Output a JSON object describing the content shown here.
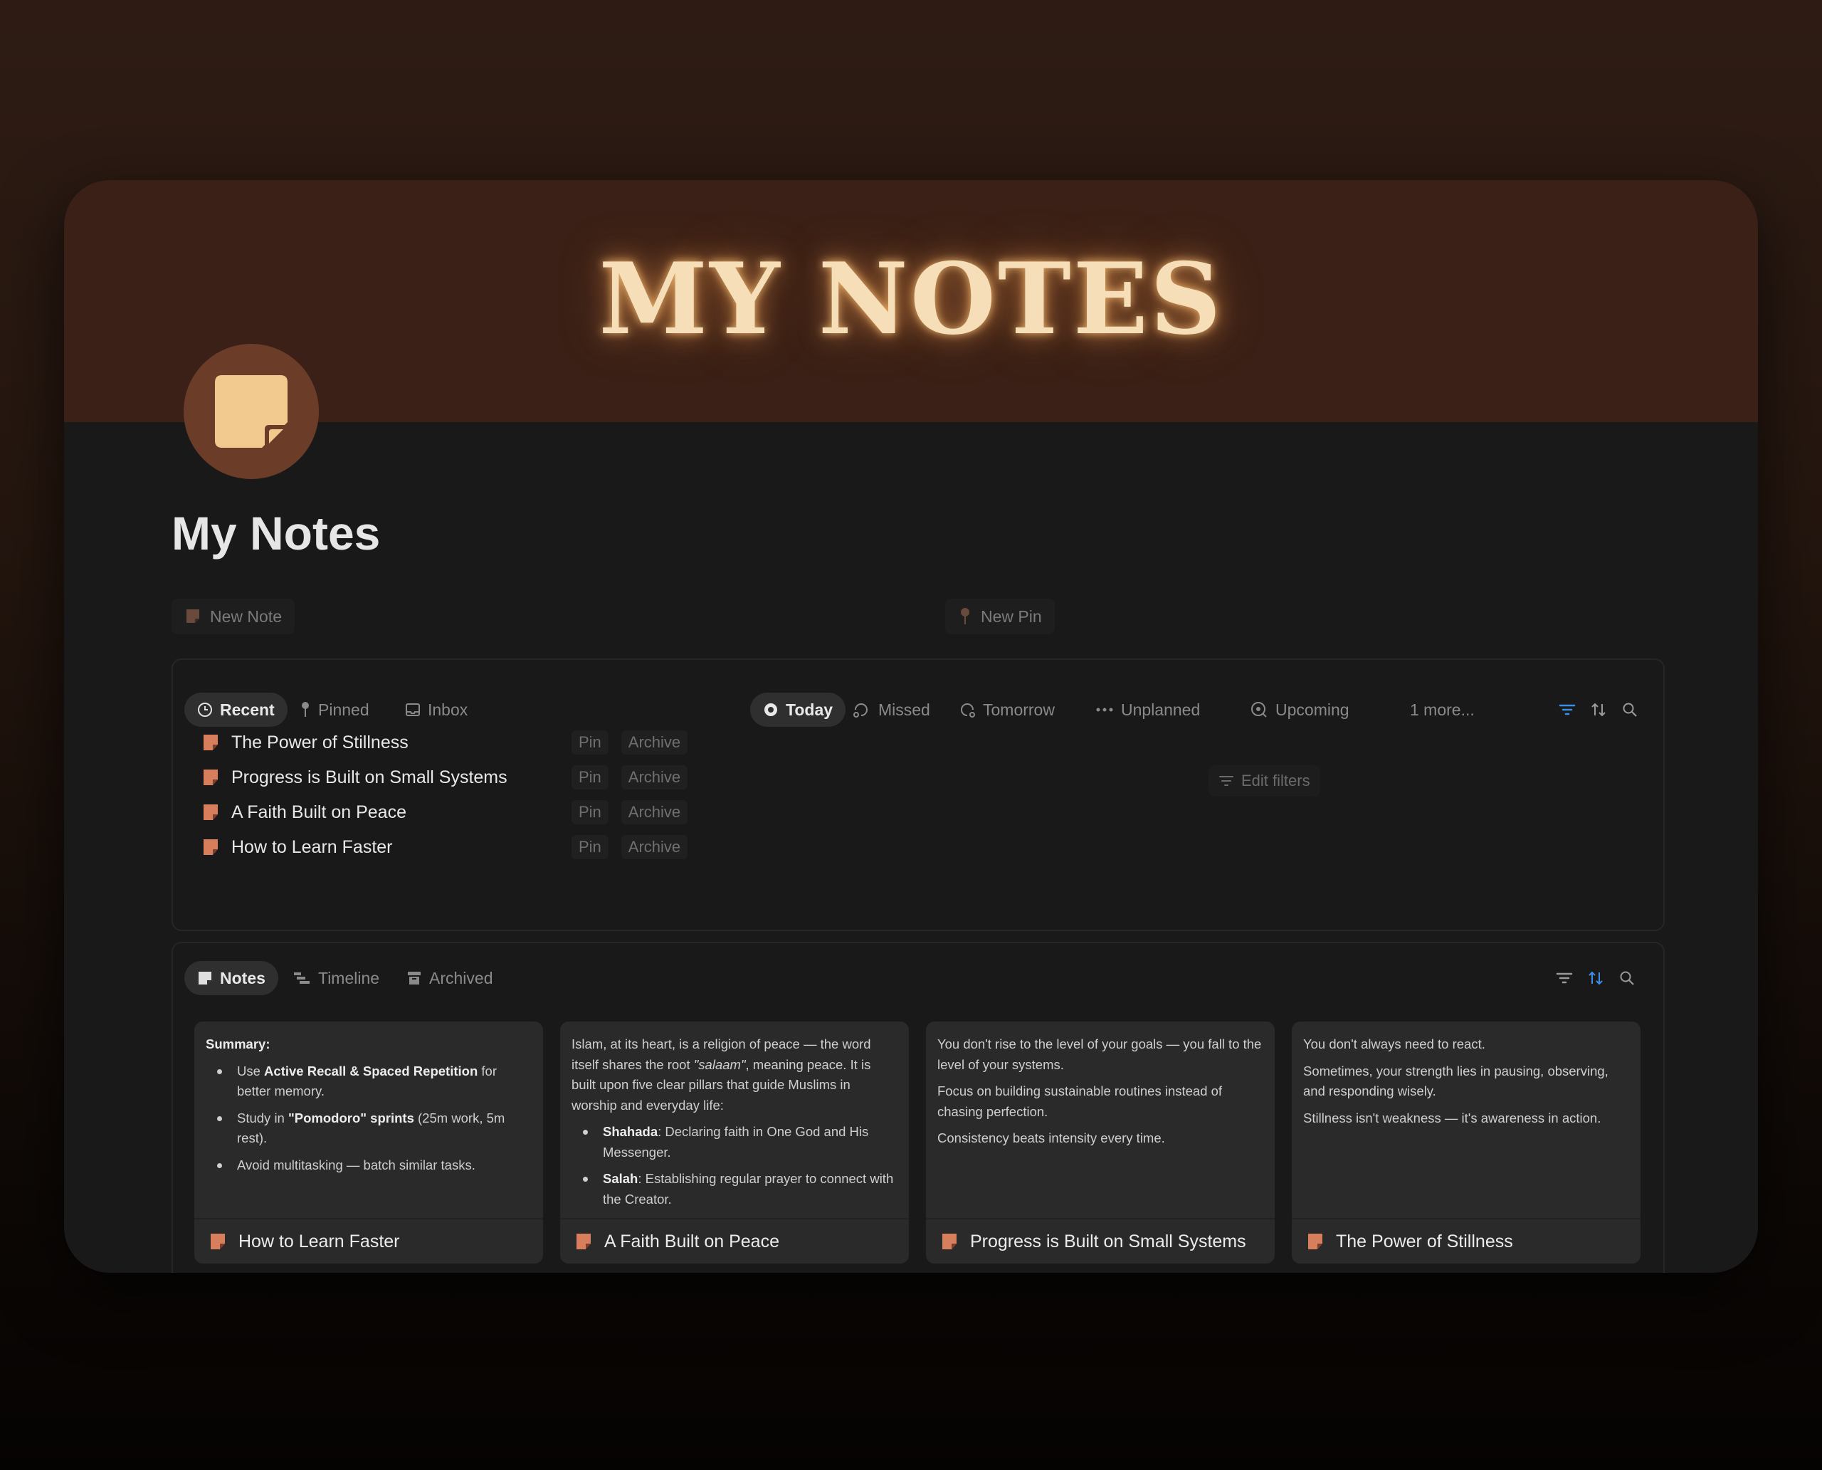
{
  "cover": {
    "title": "MY NOTES"
  },
  "page": {
    "title": "My Notes",
    "icon": "sticky-note-icon",
    "accent": "#d77f5d",
    "cover_color": "#3a2016"
  },
  "actions": {
    "new_note": "New Note",
    "new_pin": "New Pin"
  },
  "recent_panel": {
    "tabs": [
      {
        "label": "Recent",
        "icon": "clock-icon",
        "active": true
      },
      {
        "label": "Pinned",
        "icon": "pin-icon",
        "active": false
      },
      {
        "label": "Inbox",
        "icon": "inbox-icon",
        "active": false
      }
    ],
    "schedule_tabs": [
      {
        "label": "Today",
        "icon": "circle-icon",
        "active": true
      },
      {
        "label": "Missed",
        "icon": "missed-icon",
        "active": false
      },
      {
        "label": "Tomorrow",
        "icon": "tomorrow-icon",
        "active": false
      },
      {
        "label": "Unplanned",
        "icon": "dots-icon",
        "active": false
      },
      {
        "label": "Upcoming",
        "icon": "upcoming-icon",
        "active": false
      },
      {
        "label": "1 more...",
        "icon": "",
        "active": false
      }
    ],
    "rows": [
      {
        "title": "The Power of Stillness",
        "pin": "Pin",
        "archive": "Archive"
      },
      {
        "title": "Progress is Built on Small Systems",
        "pin": "Pin",
        "archive": "Archive"
      },
      {
        "title": "A Faith Built on Peace",
        "pin": "Pin",
        "archive": "Archive"
      },
      {
        "title": "How to Learn Faster",
        "pin": "Pin",
        "archive": "Archive"
      }
    ],
    "edit_filters": "Edit filters",
    "filter_active_color": "#3b8fe8"
  },
  "notes_panel": {
    "tabs": [
      {
        "label": "Notes",
        "icon": "note-icon",
        "active": true
      },
      {
        "label": "Timeline",
        "icon": "timeline-icon",
        "active": false
      },
      {
        "label": "Archived",
        "icon": "archive-box-icon",
        "active": false
      }
    ],
    "cards": [
      {
        "title": "How to Learn Faster",
        "summary_label": "Summary:",
        "b1_pre": "Use ",
        "b1_bold": "Active Recall & Spaced Repetition",
        "b1_post": " for better memory.",
        "b2_pre": "Study in ",
        "b2_bold": "\"Pomodoro\" sprints",
        "b2_post": " (25m work, 5m rest).",
        "b3": "Avoid multitasking — batch similar tasks."
      },
      {
        "title": "A Faith Built on Peace",
        "p1_pre": "Islam, at its heart, is a religion of peace — the word itself shares the root ",
        "p1_italic": "\"salaam\"",
        "p1_post": ", meaning peace. It is built upon five clear pillars that guide Muslims in worship and everyday life:",
        "b1_bold": "Shahada",
        "b1_post": ": Declaring faith in One God and His Messenger.",
        "b2_bold": "Salah",
        "b2_post": ": Establishing regular prayer to connect with the Creator."
      },
      {
        "title": "Progress is Built on Small Systems",
        "p1": "You don't rise to the level of your goals — you fall to the level of your systems.",
        "p2": "Focus on building sustainable routines instead of chasing perfection.",
        "p3": "Consistency beats intensity every time."
      },
      {
        "title": "The Power of Stillness",
        "p1": "You don't always need to react.",
        "p2": "Sometimes, your strength lies in pausing, observing, and responding wisely.",
        "p3": "Stillness isn't weakness — it's awareness in action."
      }
    ],
    "sort_active_color": "#3b8fe8"
  }
}
